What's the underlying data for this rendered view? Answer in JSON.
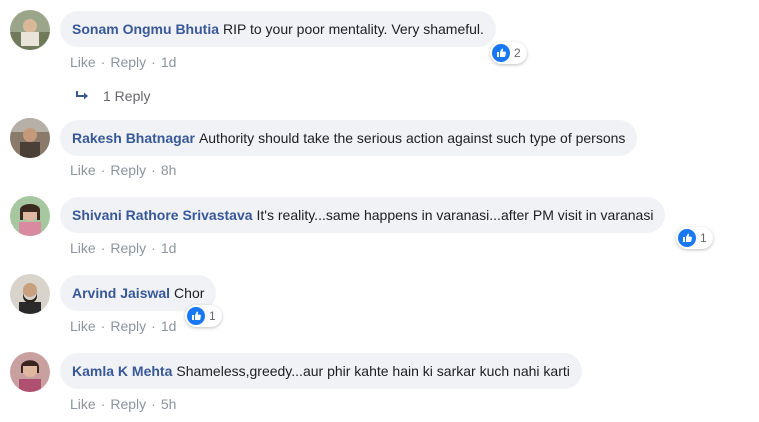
{
  "actions": {
    "like": "Like",
    "reply": "Reply",
    "sep": "·"
  },
  "comments": [
    {
      "author": "Sonam Ongmu Bhutia",
      "text": "RIP to your poor mentality. Very shameful.",
      "time": "1d",
      "reactions": "2",
      "reply_link": "1 Reply"
    },
    {
      "author": "Rakesh Bhatnagar",
      "text": "Authority should take the serious action against such type of persons",
      "time": "8h"
    },
    {
      "author": "Shivani Rathore Srivastava",
      "text": "It's reality...same happens in varanasi...after PM visit in varanasi",
      "time": "1d",
      "reactions": "1"
    },
    {
      "author": "Arvind Jaiswal",
      "text": "Chor",
      "time": "1d",
      "reactions": "1"
    },
    {
      "author": "Kamla K Mehta",
      "text": "Shameless,greedy...aur phir kahte hain ki sarkar kuch nahi karti",
      "time": "5h"
    }
  ],
  "colors": {
    "author": "#385898",
    "bubble": "#f0f2f5",
    "like_blue": "#1877f2",
    "meta": "#8d949e"
  }
}
